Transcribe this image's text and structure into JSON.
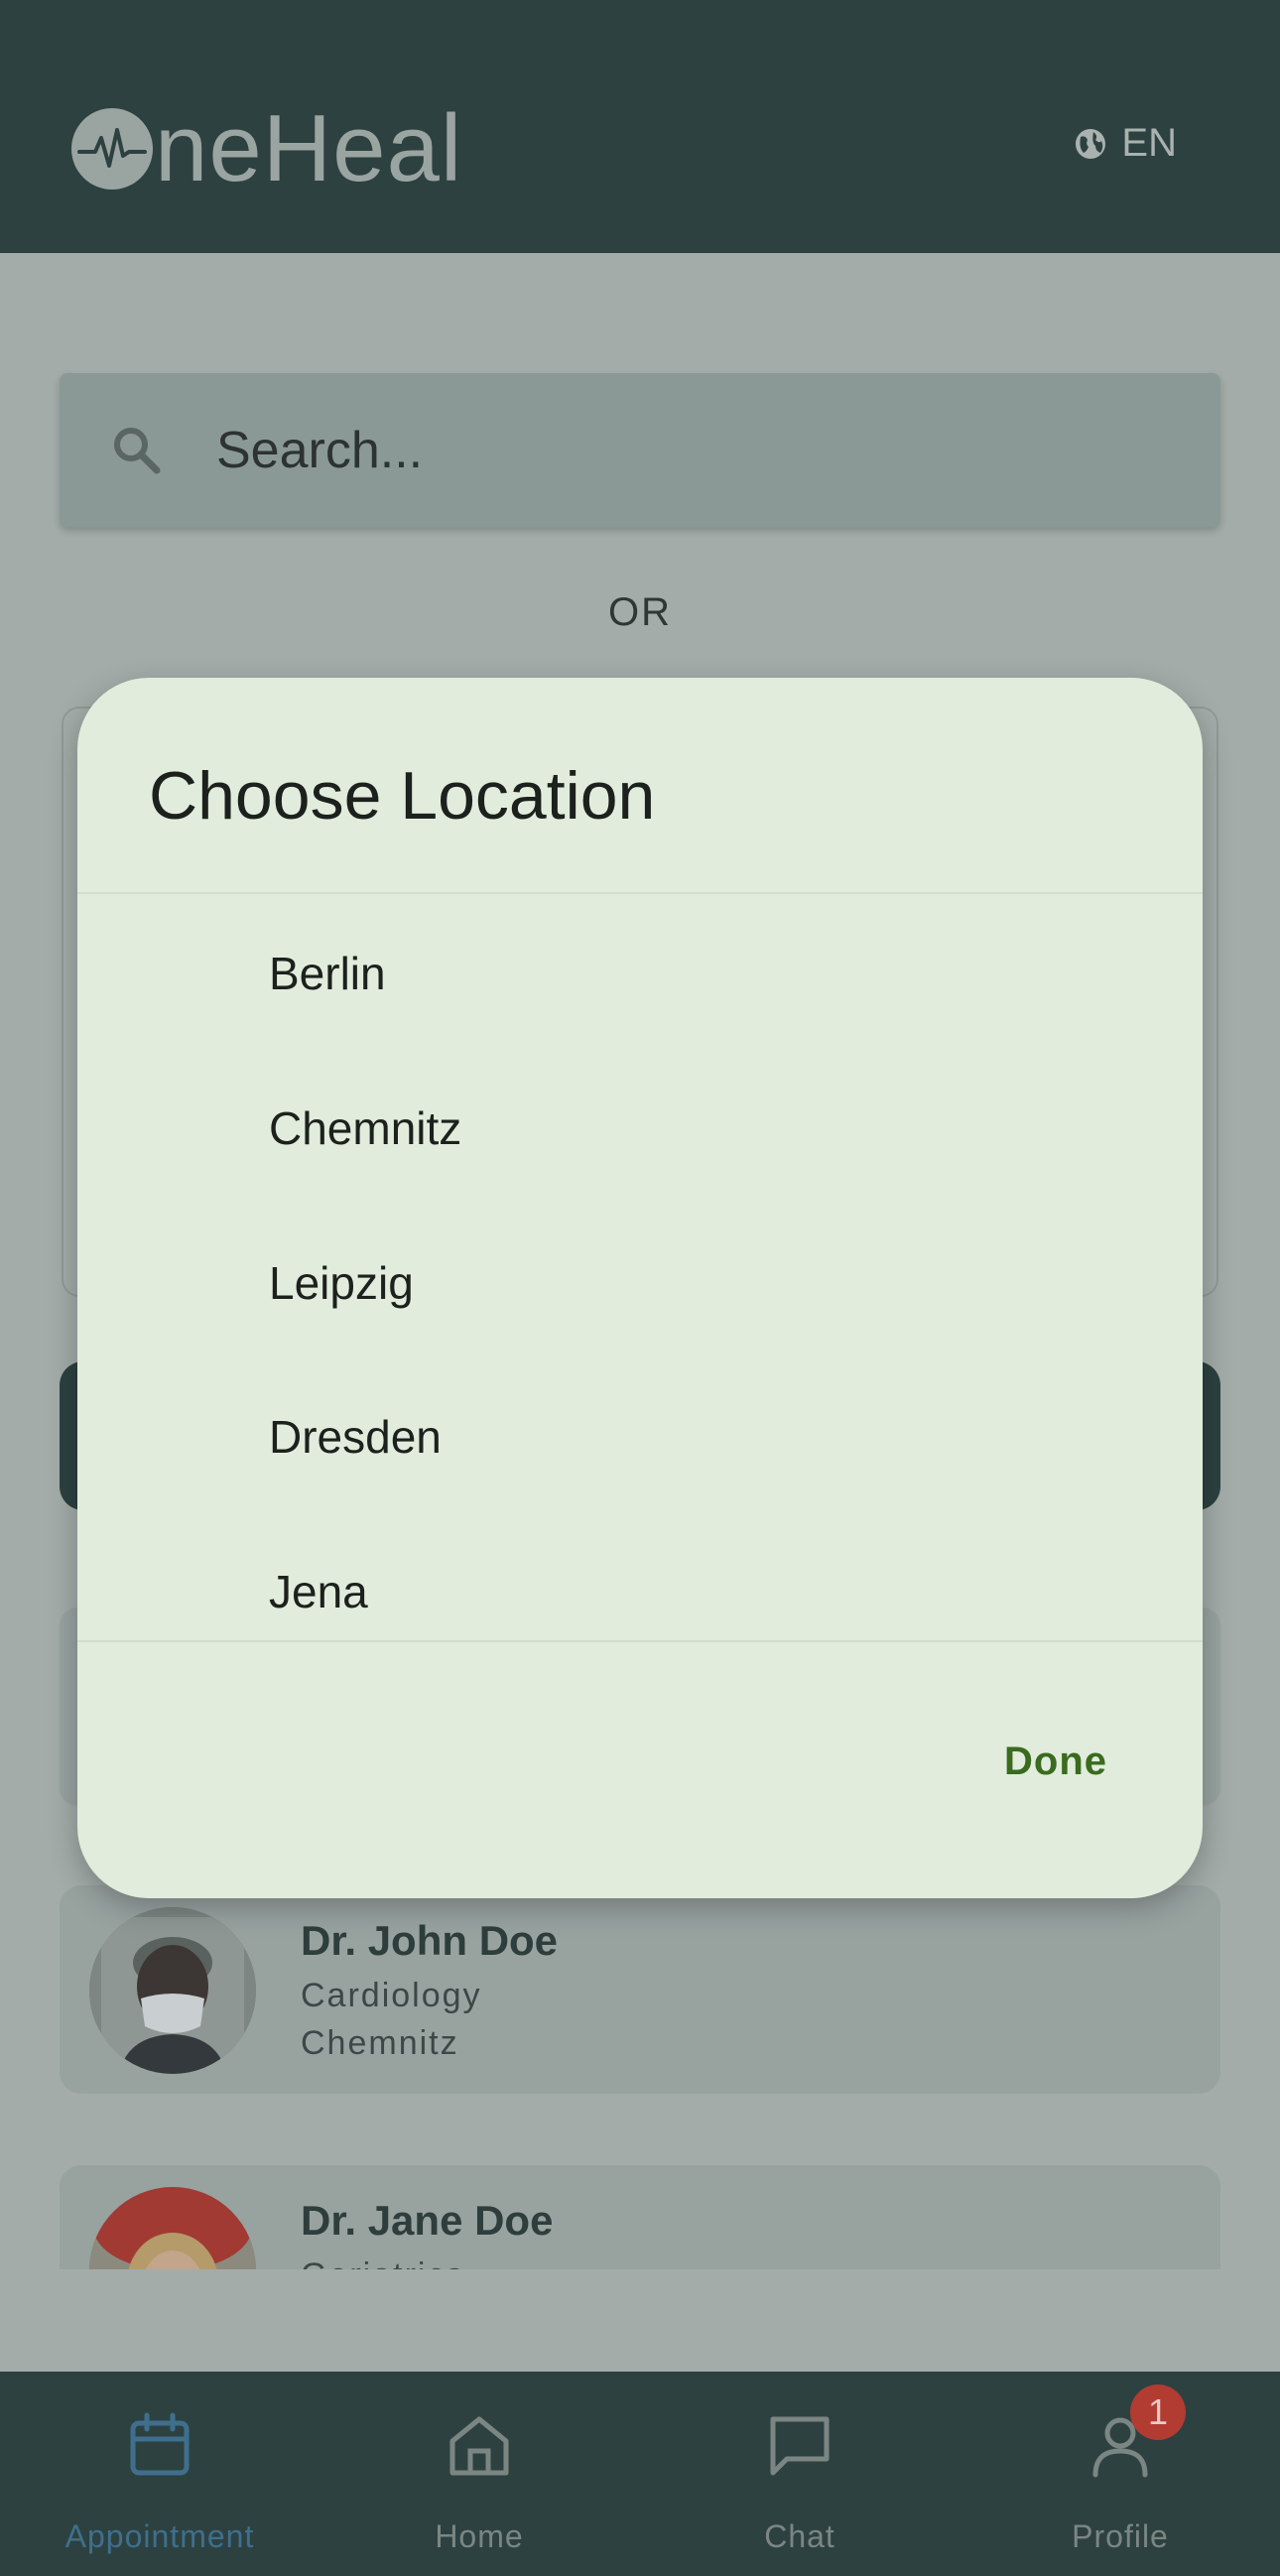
{
  "header": {
    "logo_text": "neHeal",
    "logo_icon": "pulse-circle-icon",
    "language": "EN",
    "language_icon": "globe-icon"
  },
  "search": {
    "placeholder": "Search...",
    "icon": "search-icon"
  },
  "or_label": "OR",
  "doctors": [
    {
      "name": "Dr. John Doe",
      "specialty": "Cardiology",
      "city": "Chemnitz"
    },
    {
      "name": "Dr. Jane Doe",
      "specialty": "Geriatrics"
    }
  ],
  "dialog": {
    "title": "Choose Location",
    "locations": [
      "Berlin",
      "Chemnitz",
      "Leipzig",
      "Dresden",
      "Jena"
    ],
    "done_label": "Done"
  },
  "bottom_nav": {
    "items": [
      {
        "label": "Appointment",
        "icon": "calendar-icon",
        "active": true
      },
      {
        "label": "Home",
        "icon": "home-icon",
        "active": false
      },
      {
        "label": "Chat",
        "icon": "chat-icon",
        "active": false
      },
      {
        "label": "Profile",
        "icon": "profile-icon",
        "active": false
      }
    ],
    "profile_badge": "1"
  },
  "colors": {
    "header_bg": "#2d4141",
    "dialog_bg": "#e1ecdd",
    "done_text": "#3a6b1f",
    "active_nav": "#3f6f8c",
    "badge": "#b23b32"
  }
}
